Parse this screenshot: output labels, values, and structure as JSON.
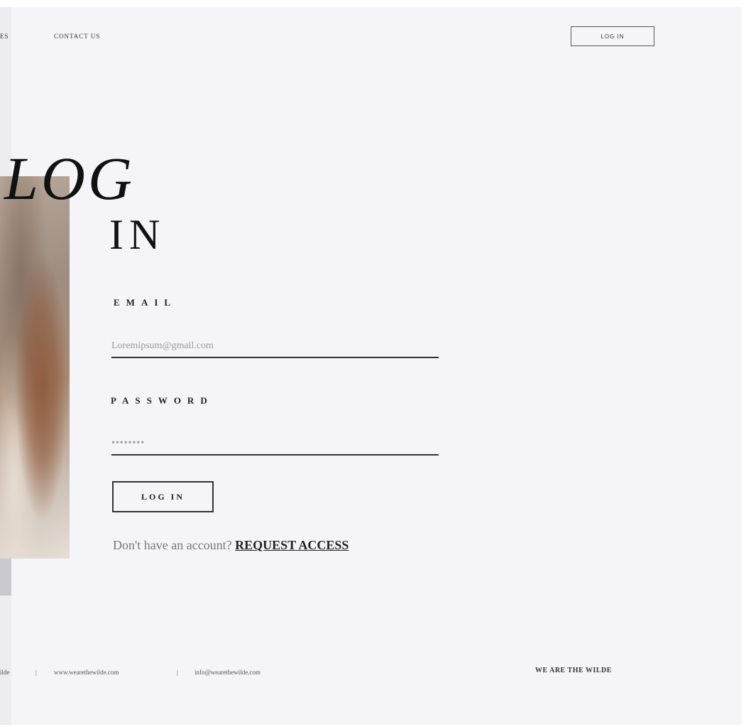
{
  "nav": {
    "left_partial": "ES",
    "contact": "CONTACT US",
    "login_button": "LOG IN"
  },
  "title": {
    "line1": "LOG",
    "line2": "IN"
  },
  "form": {
    "email_label": "EMAIL",
    "email_value": "Loremipsum@gmail.com",
    "password_label": "PASSWORD",
    "password_value": "••••••••",
    "submit_label": "LOG IN",
    "request_prompt": "Don't have an account? ",
    "request_link": "REQUEST ACCESS"
  },
  "footer": {
    "left_partial": "ilde",
    "separator": "|",
    "website": "www.wearethewilde.com",
    "email": "info@wearethewilde.com",
    "brand": "WE ARE THE WILDE"
  }
}
